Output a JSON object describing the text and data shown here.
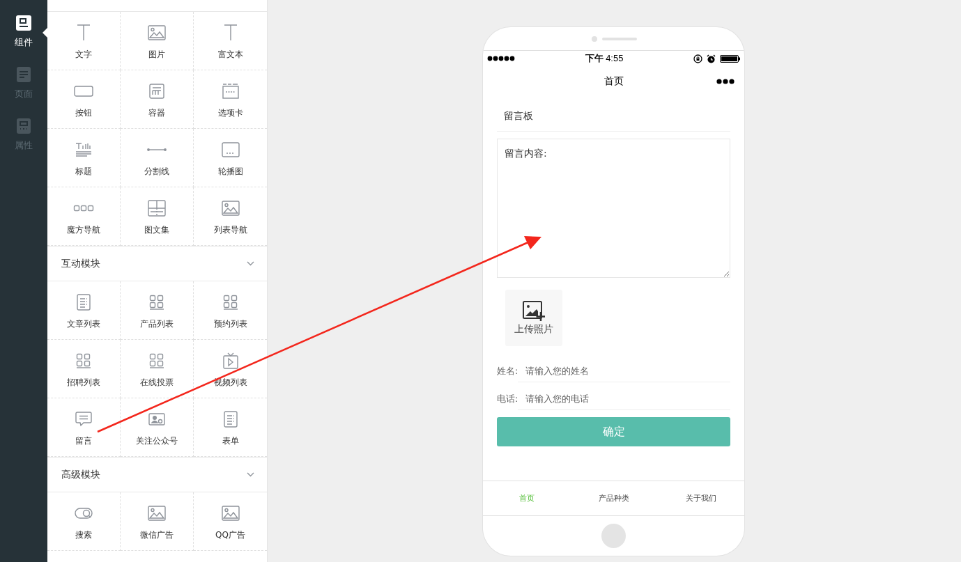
{
  "nav": [
    {
      "label": "组件",
      "kind": "component",
      "selected": true
    },
    {
      "label": "页面",
      "kind": "page",
      "selected": false
    },
    {
      "label": "属性",
      "kind": "property",
      "selected": false
    }
  ],
  "palette": {
    "sections": [
      {
        "items": [
          {
            "label": "文字",
            "kind": "text"
          },
          {
            "label": "图片",
            "kind": "image"
          },
          {
            "label": "富文本",
            "kind": "text"
          },
          {
            "label": "按钮",
            "kind": "button"
          },
          {
            "label": "容器",
            "kind": "container"
          },
          {
            "label": "选项卡",
            "kind": "tab"
          },
          {
            "label": "标题",
            "kind": "title"
          },
          {
            "label": "分割线",
            "kind": "divider"
          },
          {
            "label": "轮播图",
            "kind": "carousel"
          },
          {
            "label": "魔方导航",
            "kind": "dots"
          },
          {
            "label": "图文集",
            "kind": "gallery"
          },
          {
            "label": "列表导航",
            "kind": "image"
          }
        ]
      },
      {
        "title": "互动模块",
        "items": [
          {
            "label": "文章列表",
            "kind": "list"
          },
          {
            "label": "产品列表",
            "kind": "grid"
          },
          {
            "label": "预约列表",
            "kind": "grid"
          },
          {
            "label": "招聘列表",
            "kind": "grid"
          },
          {
            "label": "在线投票",
            "kind": "grid"
          },
          {
            "label": "视频列表",
            "kind": "video"
          },
          {
            "label": "留言",
            "kind": "comment"
          },
          {
            "label": "关注公众号",
            "kind": "profile"
          },
          {
            "label": "表单",
            "kind": "list"
          }
        ]
      },
      {
        "title": "高级模块",
        "items": [
          {
            "label": "搜索",
            "kind": "search"
          },
          {
            "label": "微信广告",
            "kind": "image"
          },
          {
            "label": "QQ广告",
            "kind": "image"
          }
        ]
      }
    ]
  },
  "phone": {
    "status_time": "**下午** 4:55",
    "nav_title": "首页",
    "form": {
      "title": "留言板",
      "message_placeholder": "留言内容:",
      "upload_label": "上传照片",
      "fields": [
        {
          "label": "姓名:",
          "placeholder": "请输入您的姓名"
        },
        {
          "label": "电话:",
          "placeholder": "请输入您的电话"
        }
      ],
      "submit": "确定"
    },
    "tabs": [
      {
        "label": "首页",
        "selected": true
      },
      {
        "label": "产品种类",
        "selected": false
      },
      {
        "label": "关于我们",
        "selected": false
      }
    ]
  }
}
